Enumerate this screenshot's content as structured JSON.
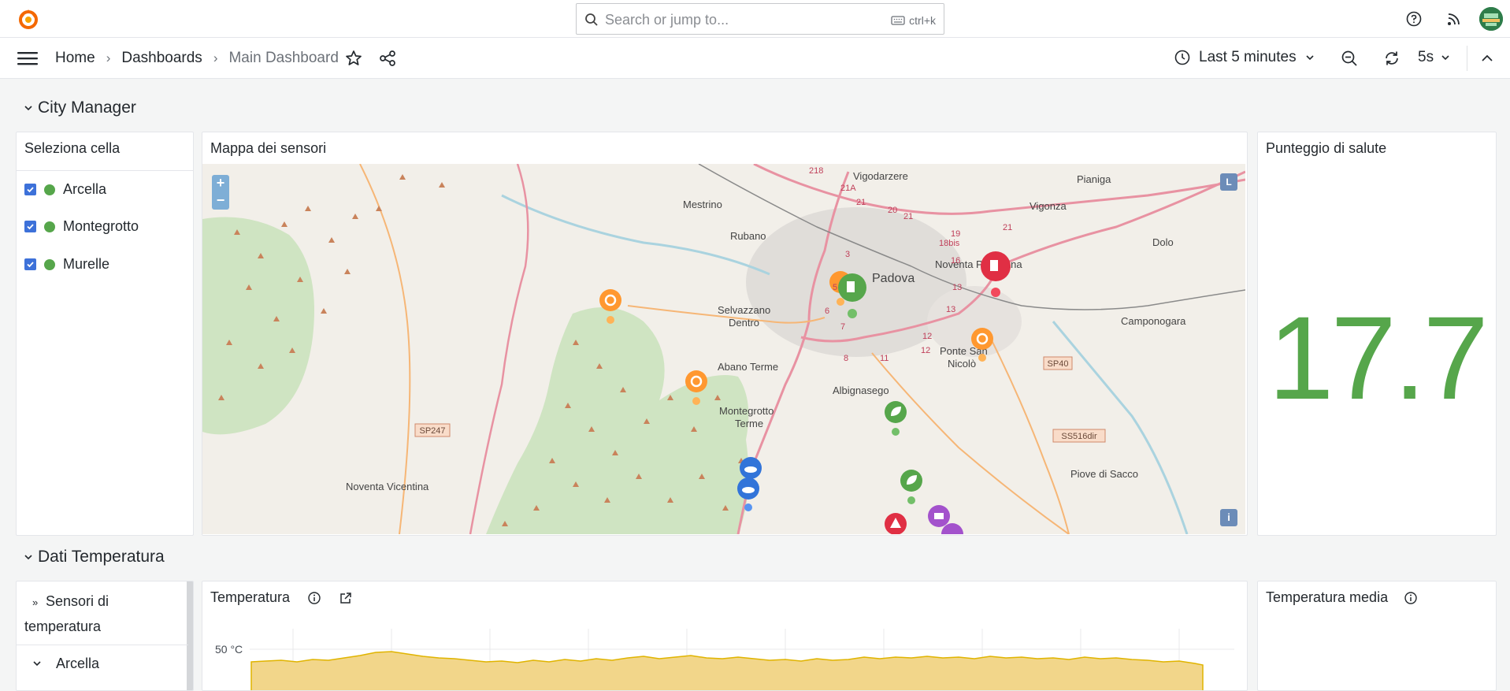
{
  "topbar": {
    "search_placeholder": "Search or jump to...",
    "search_shortcut": "ctrl+k"
  },
  "breadcrumb": {
    "home": "Home",
    "dashboards": "Dashboards",
    "current": "Main Dashboard"
  },
  "toolbar": {
    "time_range": "Last 5 minutes",
    "refresh_interval": "5s"
  },
  "rows": {
    "city_manager": "City Manager",
    "dati_temperatura": "Dati Temperatura"
  },
  "cell_selector": {
    "title": "Seleziona cella",
    "items": [
      {
        "label": "Arcella",
        "checked": true,
        "color": "#56a64b"
      },
      {
        "label": "Montegrotto",
        "checked": true,
        "color": "#56a64b"
      },
      {
        "label": "Murelle",
        "checked": true,
        "color": "#56a64b"
      }
    ]
  },
  "map_panel": {
    "title": "Mappa dei sensori",
    "zoom_in": "+",
    "zoom_out": "−",
    "places": [
      "Vigodarzere",
      "Pianiga",
      "Mestrino",
      "Vigonza",
      "Rubano",
      "Dolo",
      "Padova",
      "Noventa Padovana",
      "Selvazzano Dentro",
      "Camponogara",
      "Abano Terme",
      "Ponte San Nicolò",
      "Albignasego",
      "Montegrotto Terme",
      "Piove di Sacco",
      "Noventa Vicentina"
    ],
    "road_labels": [
      "SP247",
      "SP40",
      "SS516dir"
    ],
    "layer_badge": "L",
    "info_badge": "i"
  },
  "health_panel": {
    "title": "Punteggio di salute",
    "value": "17.7",
    "color": "#56a64b"
  },
  "temp_tree": {
    "header": "Sensori di temperatura",
    "item": "Arcella"
  },
  "temp_chart": {
    "title": "Temperatura",
    "y_tick": "50 °C"
  },
  "temp_avg": {
    "title": "Temperatura media"
  },
  "chart_data": {
    "type": "area",
    "title": "Temperatura",
    "ytick_labels": [
      "50 °C"
    ],
    "series_color": "#f2cc0c"
  }
}
